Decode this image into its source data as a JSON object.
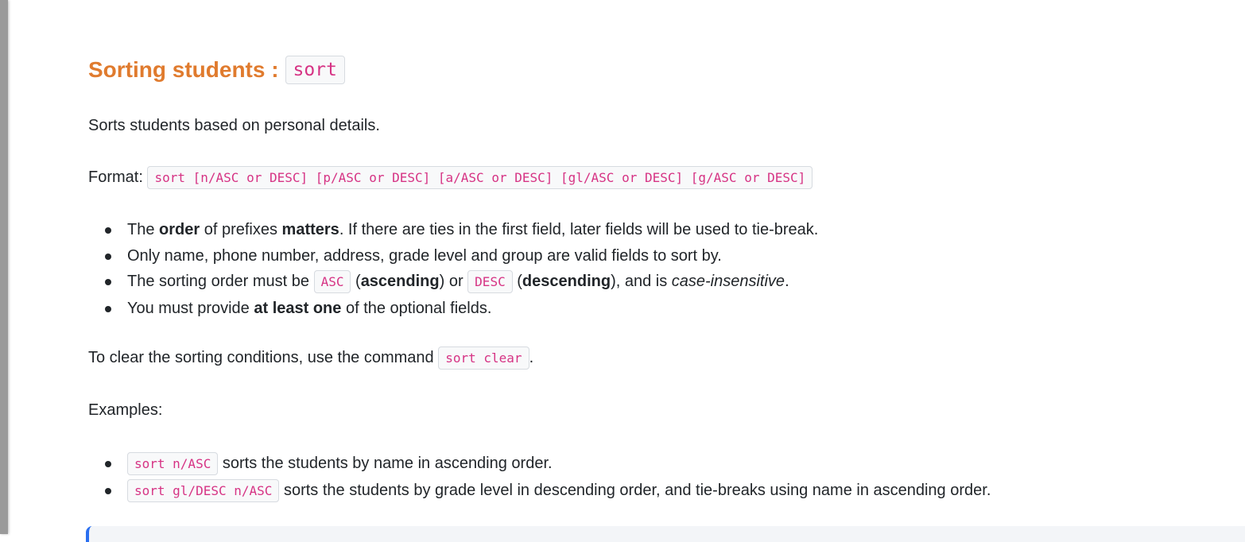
{
  "title": {
    "text": "Sorting students :",
    "code": "sort"
  },
  "description": "Sorts students based on personal details.",
  "format": {
    "label": "Format:",
    "code": "sort [n/ASC or DESC] [p/ASC or DESC] [a/ASC or DESC] [gl/ASC or DESC] [g/ASC or DESC]"
  },
  "notes": [
    {
      "parts": [
        "The ",
        "order",
        " of prefixes ",
        "matters",
        ". If there are ties in the first field, later fields will be used to tie-break."
      ]
    },
    {
      "text": "Only name, phone number, address, grade level and group are valid fields to sort by."
    },
    {
      "parts": [
        "The sorting order must be ",
        "ASC",
        " (",
        "ascending",
        ") or ",
        "DESC",
        " (",
        "descending",
        "), and is ",
        "case-insensitive",
        "."
      ]
    },
    {
      "parts": [
        "You must provide ",
        "at least one",
        " of the optional fields."
      ]
    }
  ],
  "clear": {
    "text": "To clear the sorting conditions, use the command ",
    "code": "sort clear",
    "end": "."
  },
  "examples_label": "Examples:",
  "examples": [
    {
      "code": "sort n/ASC",
      "text": " sorts the students by name in ascending order."
    },
    {
      "code": "sort gl/DESC n/ASC",
      "text": " sorts the students by grade level in descending order, and tie-breaks using name in ascending order."
    }
  ]
}
